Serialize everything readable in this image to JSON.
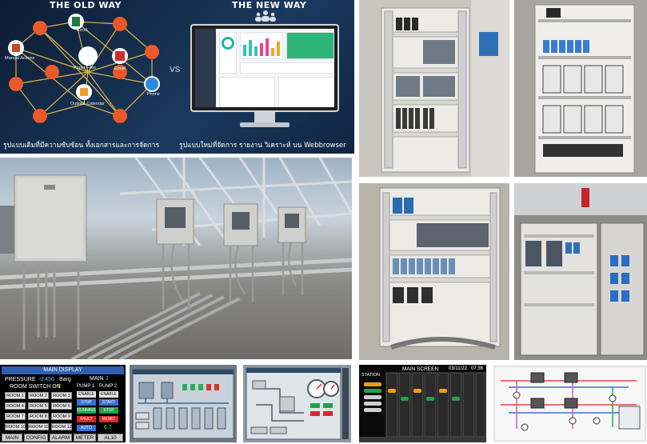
{
  "compare": {
    "old_title": "THE OLD WAY",
    "new_title": "THE NEW WAY",
    "vs": "VS",
    "old_caption": "รูปแบบเดิมที่มีความซับซ้อน ทั้งเอกสารและการจัดการ",
    "new_caption": "รูปแบบใหม่ที่จัดการ รายงาน วิเคราะห์ บน Webbrowser",
    "nodes": [
      "Excel",
      "Paper Files",
      "Manual Actions",
      "Email",
      "Outlook Calendar",
      "Phone"
    ]
  },
  "hmi_main": {
    "header": "MAIN DISPLAY",
    "pressure_label": "PRESSURE",
    "pressure_value": "-0.450",
    "pressure_unit": "Barg",
    "room_switch_label": "ROOM SWITCH ON",
    "room_switch_value": "1",
    "main_label": "MAIN",
    "main_value": "1",
    "rooms": [
      "ROOM 1",
      "ROOM 2",
      "ROOM 3",
      "ROOM 4",
      "ROOM 5",
      "ROOM 6",
      "ROOM 7",
      "ROOM 8",
      "ROOM 9",
      "ROOM 10",
      "ROOM 11",
      "ROOM 12"
    ],
    "pump1": "PUMP 1",
    "pump2": "PUMP 2",
    "pump_buttons": [
      "ENABLE",
      "ENABLE",
      "STOP",
      "START",
      "RUNNING",
      "STOP",
      "FAULT",
      "RESET",
      "AUTO"
    ],
    "counter_value": "6.7",
    "tabs": [
      "MAIN",
      "CONFIG",
      "ALARM",
      "METER",
      "AL10"
    ]
  },
  "hmi_station": {
    "header": "MAIN SCREEN",
    "date": "03/11/22",
    "time": "07:36",
    "station_label": "STATION"
  },
  "colors": {
    "hmi_header": "#2f5fb0",
    "running_green": "#1fa34a",
    "fault_red": "#d42a2a"
  }
}
